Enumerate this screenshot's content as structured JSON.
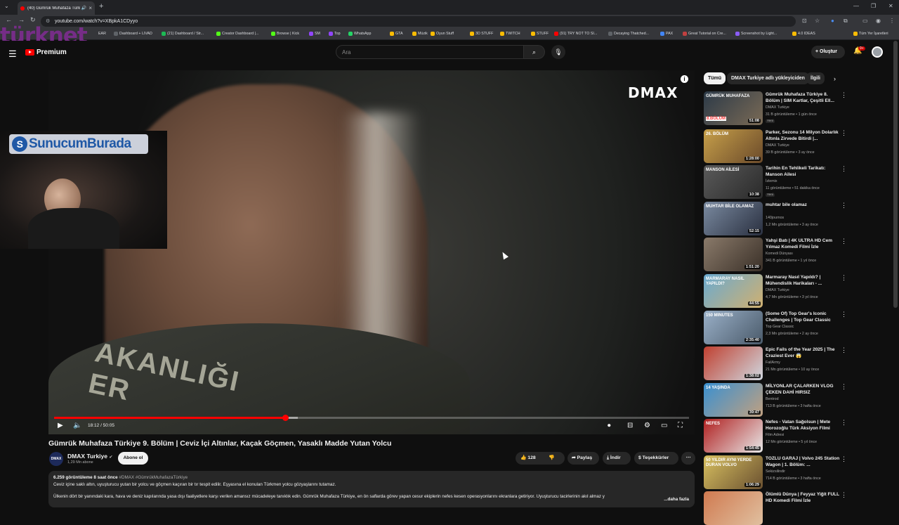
{
  "browser": {
    "tab_title": "(40) Gümrük Muhafaza Türk",
    "url": "youtube.com/watch?v=XBpkA1CDyyo",
    "bookmarks": [
      "Dashboard + LIVAD",
      "(21) Dashboard / Str...",
      "Creator Dashboard |...",
      "Browse | Kick",
      "SM",
      "Top",
      "WhatsApp",
      "GTA",
      "Müzik",
      "Oyun Stuff",
      "3D STUFF",
      "TWITCH",
      "STUFF",
      "(91) TRY NOT TO SI...",
      "Decaying Thatched...",
      "PAX",
      "Great Tutorial on Cre...",
      "Screenshot by Light...",
      "4.0 IDEAS",
      "Tüm Yer İşaretleri"
    ],
    "bookmark_prefix": "EAR"
  },
  "overlay": {
    "brand": "türknet",
    "banner": "SunucumBurada"
  },
  "header": {
    "logo": "Premium",
    "search_placeholder": "Ara",
    "create_label": "Oluştur",
    "notif_count": "9+"
  },
  "player": {
    "watermark": "DMAX",
    "shirt_text": "AKANLIĞI",
    "shirt_text2": "ER",
    "time": "18:12 / 50:05",
    "progress": 0.3636,
    "buffered": 0.3836
  },
  "video": {
    "title": "Gümrük Muhafaza Türkiye 9. Bölüm | Ceviz İçi Altınlar, Kaçak Göçmen, Yasaklı Madde Yutan Yolcu",
    "channel": "DMAX Turkiye",
    "channel_avatar": "DMAX",
    "subscribers": "1,29 Mn abone",
    "subscribe_label": "Abone ol",
    "likes": "128",
    "share_label": "Paylaş",
    "download_label": "İndir",
    "thanks_label": "Teşekkürler",
    "desc_meta": "6.259 görüntüleme  8 saat önce",
    "desc_tags": "#DMAX #GümrükMuhafazaTürkiye",
    "desc_line1": "Ceviz içine saklı altın, uyuşturucu yutan bir yolcu ve göçmen kaçıran bir tır tespit edilir. Eşyasına el konulan Türkmen yolcu gözyaşlarını tutamaz.",
    "desc_line2": "Ülkenin dört bir yanındaki kara, hava ve deniz kapılarında yasa dışı faaliyetlere karşı verilen amansız mücadeleye tanıklık edin. Gümrük Muhafaza Türkiye, en ön saflarda görev yapan cesur ekiplerin nefes kesen operasyonlarını ekranlara getiriyor. Uyuşturucu tacirlerinin akıl almaz y",
    "desc_more": "...daha fazla"
  },
  "chips": [
    "Tümü",
    "DMAX Turkiye adlı yükleyiciden",
    "İlgili"
  ],
  "recommendations": [
    {
      "title": "Gümrük Muhafaza Türkiye 8. Bölüm | SIM Kartlar, Çeşitli Ell...",
      "channel": "DMAX Turkiye",
      "meta": "31 B görüntüleme • 1 gün önce",
      "badge": "Yeni",
      "duration": "51:08",
      "thumb_text": "GÜMRÜK MUHAFAZA",
      "thumb_text2": "8.BÖLÜM",
      "c1": "#2c3a48",
      "c2": "#7a6a55"
    },
    {
      "title": "Parker, Sezonu 14 Milyon Dolarlık Altınla Zirvede Bitirdi |...",
      "channel": "DMAX Turkiye",
      "meta": "39 B görüntüleme • 3 ay önce",
      "badge": "",
      "duration": "1:28:00",
      "thumb_text": "26. BÖLÜM",
      "thumb_text2": "",
      "c1": "#c7a04a",
      "c2": "#6b4a2a"
    },
    {
      "title": "Tarihin En Tehlikeli Tarikatı: Manson Ailesi",
      "channel": "İzlemix",
      "meta": "11 görüntüleme • 51 dakika önce",
      "badge": "Yeni",
      "duration": "10:38",
      "thumb_text": "MANSON AİLESİ",
      "thumb_text2": "",
      "c1": "#5a5a5a",
      "c2": "#2a2a2a"
    },
    {
      "title": "muhtar bile olamaz",
      "channel": "140journos",
      "meta": "1,2 Mn görüntüleme • 3 ay önce",
      "badge": "",
      "duration": "52:15",
      "thumb_text": "MUHTAR BİLE OLAMAZ",
      "thumb_text2": "",
      "c1": "#7a8aa0",
      "c2": "#2a3040"
    },
    {
      "title": "Yahşi Batı | 4K ULTRA HD Cem Yılmaz Komedi Filmi İzle",
      "channel": "Komedi Dünyası",
      "meta": "341 B görüntüleme • 1 yıl önce",
      "badge": "",
      "duration": "1:51:20",
      "thumb_text": "",
      "thumb_text2": "",
      "c1": "#8a7a6a",
      "c2": "#3a3028"
    },
    {
      "title": "Marmaray Nasıl Yapıldı? | Mühendislik Harikaları - ...",
      "channel": "DMAX Turkiye",
      "meta": "4,7 Mn görüntüleme • 3 yıl önce",
      "badge": "",
      "duration": "44:55",
      "thumb_text": "MARMARAY NASIL YAPILDI?",
      "thumb_text2": "",
      "c1": "#6aaad0",
      "c2": "#d0b070"
    },
    {
      "title": "(Some Of) Top Gear's Iconic Challenges | Top Gear Classic",
      "channel": "Top Gear Classic",
      "meta": "2,3 Mn görüntüleme • 2 ay önce",
      "badge": "",
      "duration": "2:35:40",
      "thumb_text": "150 MINUTES",
      "thumb_text2": "",
      "c1": "#9ab0c8",
      "c2": "#4a5a6a"
    },
    {
      "title": "Epic Fails of the Year 2025 | The Craziest Ever 😱",
      "channel": "FailArmy",
      "meta": "21 Mn görüntüleme • 10 ay önce",
      "badge": "",
      "duration": "1:38:02",
      "thumb_text": "",
      "thumb_text2": "",
      "c1": "#c04030",
      "c2": "#d0d8e0"
    },
    {
      "title": "MİLYONLAR ÇALARKEN VLOG ÇEKEN DAHİ HIRSIZ",
      "channel": "Bentrod",
      "meta": "713 B görüntüleme • 3 hafta önce",
      "badge": "",
      "duration": "39:47",
      "thumb_text": "14 YAŞINDA",
      "thumb_text2": "",
      "c1": "#3a90d0",
      "c2": "#c0a080"
    },
    {
      "title": "Nefes - Vatan Sağolsun | Mete Horozoğlu Türk Aksiyon Filmi",
      "channel": "Film Adresi",
      "meta": "12 Mn görüntüleme • 5 yıl önce",
      "badge": "",
      "duration": "1:54:45",
      "thumb_text": "NEFES",
      "thumb_text2": "",
      "c1": "#b02020",
      "c2": "#e8e8e8"
    },
    {
      "title": "TOZLU GARAJ | Volvo 245 Station Wagon | 1. Bölüm: ...",
      "channel": "Sekizsilindir",
      "meta": "714 B görüntüleme • 3 hafta önce",
      "badge": "",
      "duration": "1:06:29",
      "thumb_text": "50 YILDIR AYNI YERDE DURAN VOLVO",
      "thumb_text2": "",
      "c1": "#d8c060",
      "c2": "#6a5030"
    },
    {
      "title": "Ölümlü Dünya | Feyyaz Yiğit FULL HD Komedi Filmi İzle",
      "channel": "",
      "meta": "",
      "badge": "",
      "duration": "",
      "thumb_text": "",
      "thumb_text2": "",
      "c1": "#d07a50",
      "c2": "#e0c0a0"
    }
  ]
}
